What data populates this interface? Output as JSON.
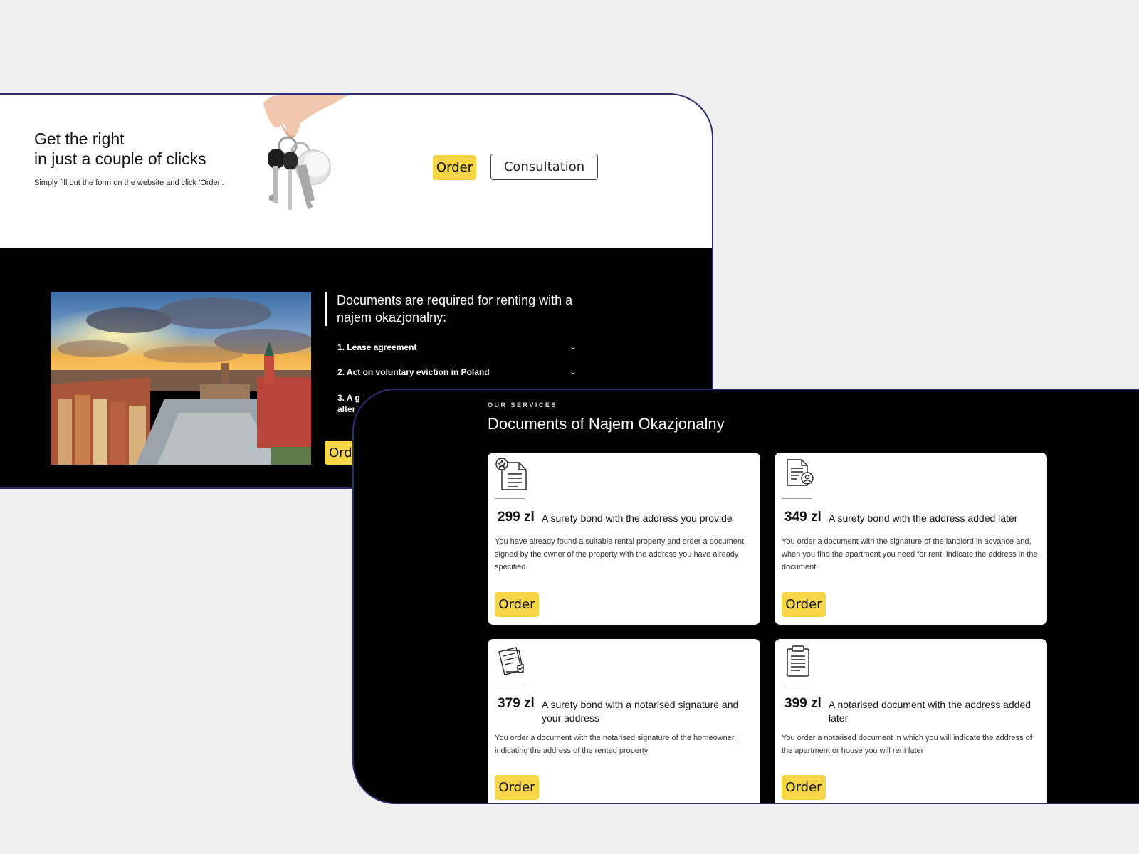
{
  "hero": {
    "title_line1": "Get the right",
    "title_line2": "in just a couple of clicks",
    "subtitle": "Simply fill out the form on the website and click 'Order'.",
    "order_label": "Order",
    "consultation_label": "Consultation"
  },
  "docs": {
    "heading": "Documents are required for renting with a najem okazjonalny:",
    "items": [
      {
        "label": "1. Lease agreement"
      },
      {
        "label": "2. Act on voluntary eviction in Poland"
      },
      {
        "label": "3. A g",
        "label_line2": "alter"
      }
    ],
    "order_label": "Ord"
  },
  "services": {
    "eyebrow": "OUR SERVICES",
    "title": "Documents of Najem Okazjonalny",
    "cards": [
      {
        "price": "299 zl",
        "name": "A surety bond with the address you provide",
        "desc": "You have already found a suitable rental property and order a document signed by the owner of the property with the address you have already specified",
        "order_label": "Order",
        "icon": "certificate-star-icon"
      },
      {
        "price": "349 zl",
        "name": "A surety bond with the address added later",
        "desc": "You order a document with the signature of the landlord in advance and, when you find the apartment you need for rent, indicate the address in the document",
        "order_label": "Order",
        "icon": "document-user-icon"
      },
      {
        "price": "379 zl",
        "name": "A surety bond with a notarised signature and your address",
        "desc": "You order a document with the notarised signature of the homeowner, indicating the address of the rented property",
        "order_label": "Order",
        "icon": "notarised-check-icon"
      },
      {
        "price": "399 zl",
        "name": "A notarised document with the address added later",
        "desc": "You order a notarised document in which you will indicate the address of the apartment or house you will rent later",
        "order_label": "Order",
        "icon": "clipboard-icon"
      }
    ]
  },
  "colors": {
    "accent": "#f6d547",
    "border": "#2a2f6e",
    "dark": "#000000"
  }
}
